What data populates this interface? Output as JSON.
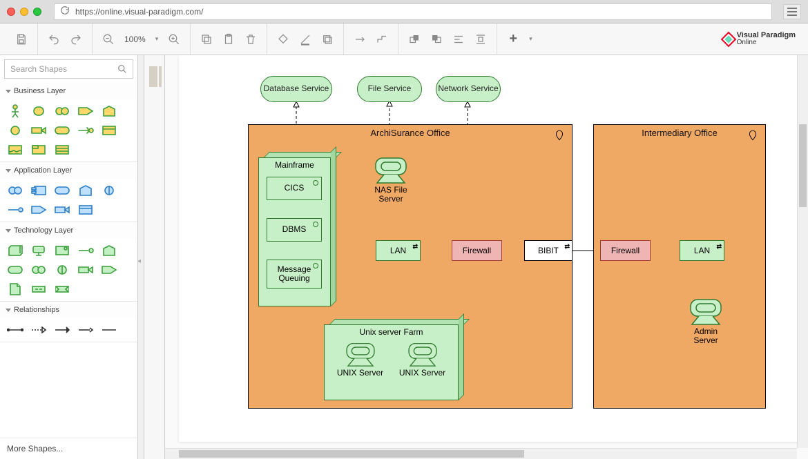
{
  "browser": {
    "url": "https://online.visual-paradigm.com/"
  },
  "toolbar": {
    "zoom": "100%"
  },
  "brand": {
    "line1": "Visual Paradigm",
    "line2": "Online"
  },
  "sidebar": {
    "search_placeholder": "Search Shapes",
    "sections": {
      "business": "Business Layer",
      "application": "Application Layer",
      "technology": "Technology Layer",
      "relationships": "Relationships"
    },
    "more": "More Shapes..."
  },
  "diagram": {
    "services": {
      "db": "Database Service",
      "file": "File Service",
      "net": "Network Service"
    },
    "locations": {
      "archi": "ArchiSurance Office",
      "inter": "Intermediary Office"
    },
    "mainframe": {
      "label": "Mainframe",
      "components": {
        "cics": "CICS",
        "dbms": "DBMS",
        "mq": "Message Queuing"
      }
    },
    "devices": {
      "nas": "NAS File Server",
      "admin": "Admin Server"
    },
    "networks": {
      "lan1": "LAN",
      "bibit": "BIBIT",
      "lan2": "LAN"
    },
    "firewalls": {
      "fw1": "Firewall",
      "fw2": "Firewall"
    },
    "farm": {
      "label": "Unix server Farm",
      "unix1": "UNIX Server",
      "unix2": "UNIX Server"
    }
  }
}
